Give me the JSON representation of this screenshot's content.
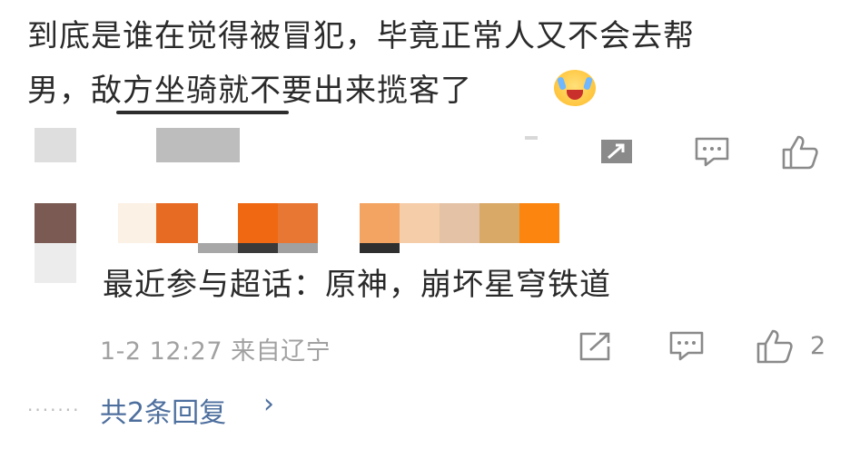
{
  "comment": {
    "line1": "到底是谁在觉得被冒犯，毕竟正常人又不会去帮",
    "line2": "男，敌方坐骑就不要出来揽客了",
    "emoji": "laughing-tears-emoji"
  },
  "reply": {
    "topics_text": "最近参与超话：原神，崩坏星穹铁道",
    "meta": "1-2 12:27 来自辽宁",
    "like_count": "2",
    "replies_label": "共2条回复",
    "replies_chevron": "›",
    "dots": "·······"
  },
  "colors": {
    "link": "#4d6f9e",
    "meta_gray": "#a1a1a1",
    "text": "#2a2a2a"
  }
}
